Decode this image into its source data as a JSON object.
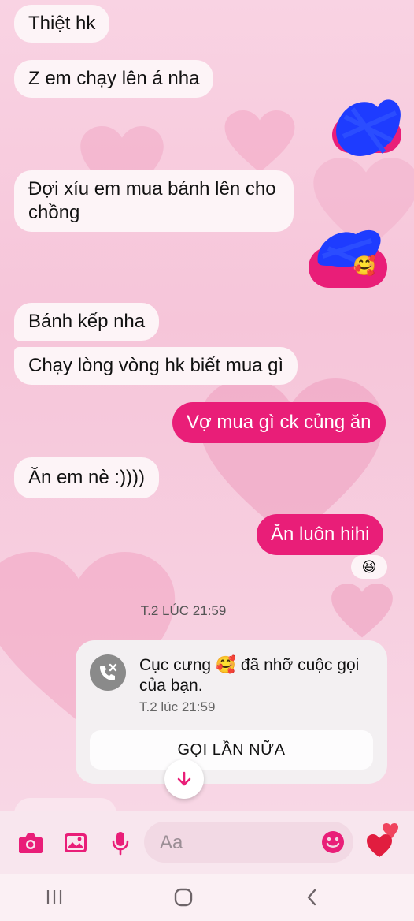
{
  "messages": [
    {
      "text": "Thiệt hk",
      "side": "in"
    },
    {
      "text": "Z em chạy lên á nha",
      "side": "in"
    },
    {
      "text": "Đợi xíu em mua bánh lên cho chồng",
      "side": "in"
    },
    {
      "text": "Bánh kếp nha",
      "side": "in"
    },
    {
      "text": "Chạy lòng vòng hk biết mua gì",
      "side": "in"
    },
    {
      "text": "Vợ mua gì ck củng ăn",
      "side": "out"
    },
    {
      "text": "Ăn em nè :))))",
      "side": "in"
    },
    {
      "text": "Ăn luôn hihi",
      "side": "out"
    }
  ],
  "reactions": {
    "out_blurred_emoji": "🥰",
    "reaction_emoji": "😆"
  },
  "timestamp_divider": "T.2 LÚC 21:59",
  "missed_call": {
    "text": "Cục cưng 🥰 đã nhỡ cuộc gọi của bạn.",
    "time": "T.2 lúc 21:59",
    "call_again_label": "GỌI LẦN NỮA"
  },
  "composer": {
    "placeholder": "Aa"
  },
  "colors": {
    "accent": "#e91e78",
    "bubble_in": "#fdf4f7",
    "scribble": "#1e3cff"
  },
  "icons": {
    "camera": "camera-icon",
    "gallery": "image-icon",
    "mic": "microphone-icon",
    "emoji": "smiley-icon",
    "send_like": "hearts-icon",
    "missed_call": "missed-call-icon",
    "scroll_down": "arrow-down-icon"
  }
}
